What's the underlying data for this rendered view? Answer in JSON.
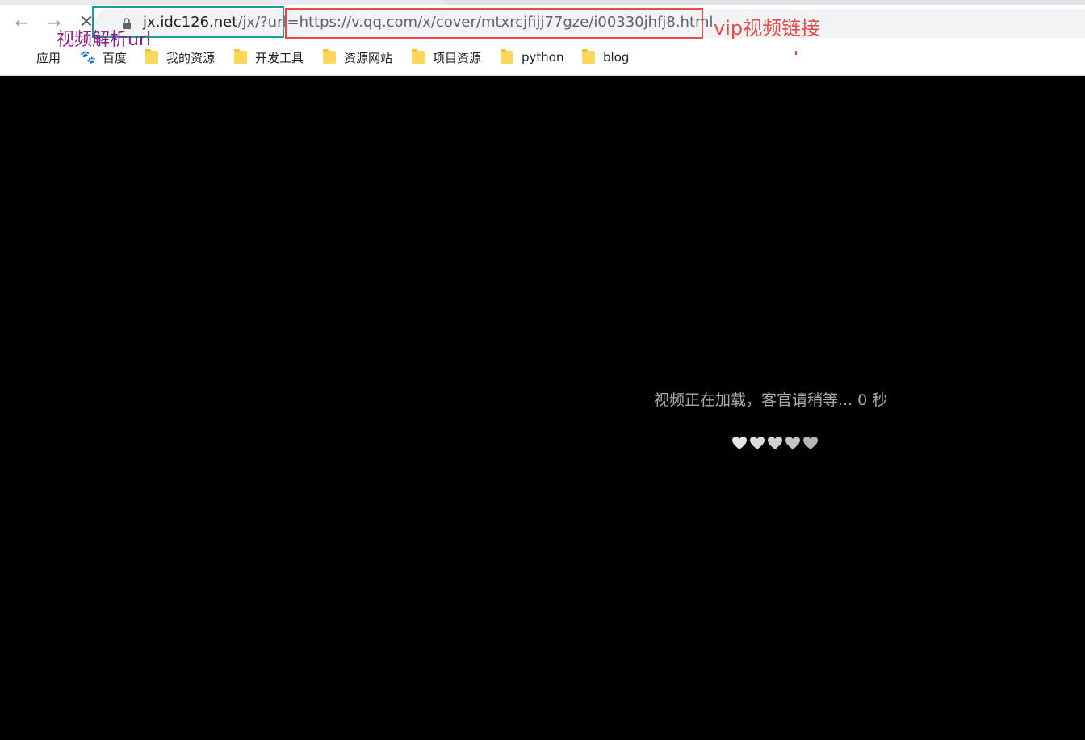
{
  "browser": {
    "nav": {
      "back_glyph": "←",
      "forward_glyph": "→",
      "stop_glyph": "✕"
    },
    "url": {
      "host_part": "jx.idc126.net",
      "path_part": "/jx/?url=",
      "target_part": "https://v.qq.com/x/cover/mtxrcjfijj77gze/i00330jhfj8.html"
    },
    "bookmarks": [
      {
        "label": "应用",
        "icon": "apps-icon"
      },
      {
        "label": "百度",
        "icon": "baidu-icon"
      },
      {
        "label": "我的资源",
        "icon": "folder-icon"
      },
      {
        "label": "开发工具",
        "icon": "folder-icon"
      },
      {
        "label": "资源网站",
        "icon": "folder-icon"
      },
      {
        "label": "项目资源",
        "icon": "folder-icon"
      },
      {
        "label": "python",
        "icon": "folder-icon"
      },
      {
        "label": "blog",
        "icon": "folder-icon"
      }
    ]
  },
  "annotations": {
    "parse_url_label": "视频解析url",
    "vip_link_label": "vip视频链接",
    "teal_color": "#1f9a95",
    "red_color": "#e84a4a",
    "purple_color": "#8b1a8b"
  },
  "player": {
    "loading_text": "视频正在加载，客官请稍等... 0 秒",
    "heart_count": 5
  }
}
